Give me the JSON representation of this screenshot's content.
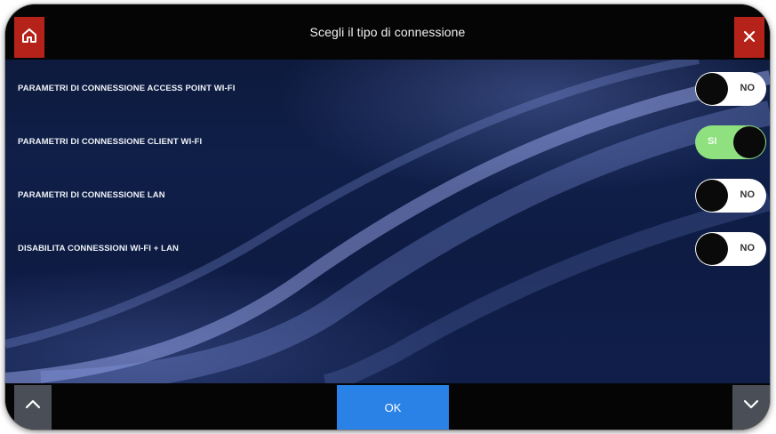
{
  "header": {
    "title": "Scegli il tipo di connessione",
    "home_icon": "home-icon",
    "close_icon": "close-icon",
    "accent_color": "#b52219"
  },
  "rows": [
    {
      "label": "PARAMETRI DI CONNESSIONE ACCESS POINT WI-FI",
      "state": "NO",
      "on": false
    },
    {
      "label": "PARAMETRI DI CONNESSIONE CLIENT WI-FI",
      "state": "SI",
      "on": true
    },
    {
      "label": "PARAMETRI DI CONNESSIONE LAN",
      "state": "NO",
      "on": false
    },
    {
      "label": "DISABILITA CONNESSIONI WI-FI + LAN",
      "state": "NO",
      "on": false
    }
  ],
  "footer": {
    "ok_label": "OK",
    "ok_color": "#2b82e6",
    "up_icon": "chevron-up-icon",
    "down_icon": "chevron-down-icon"
  },
  "colors": {
    "toggle_on": "#8fe07f",
    "toggle_off": "#ffffff",
    "background": "#0f1f48"
  }
}
